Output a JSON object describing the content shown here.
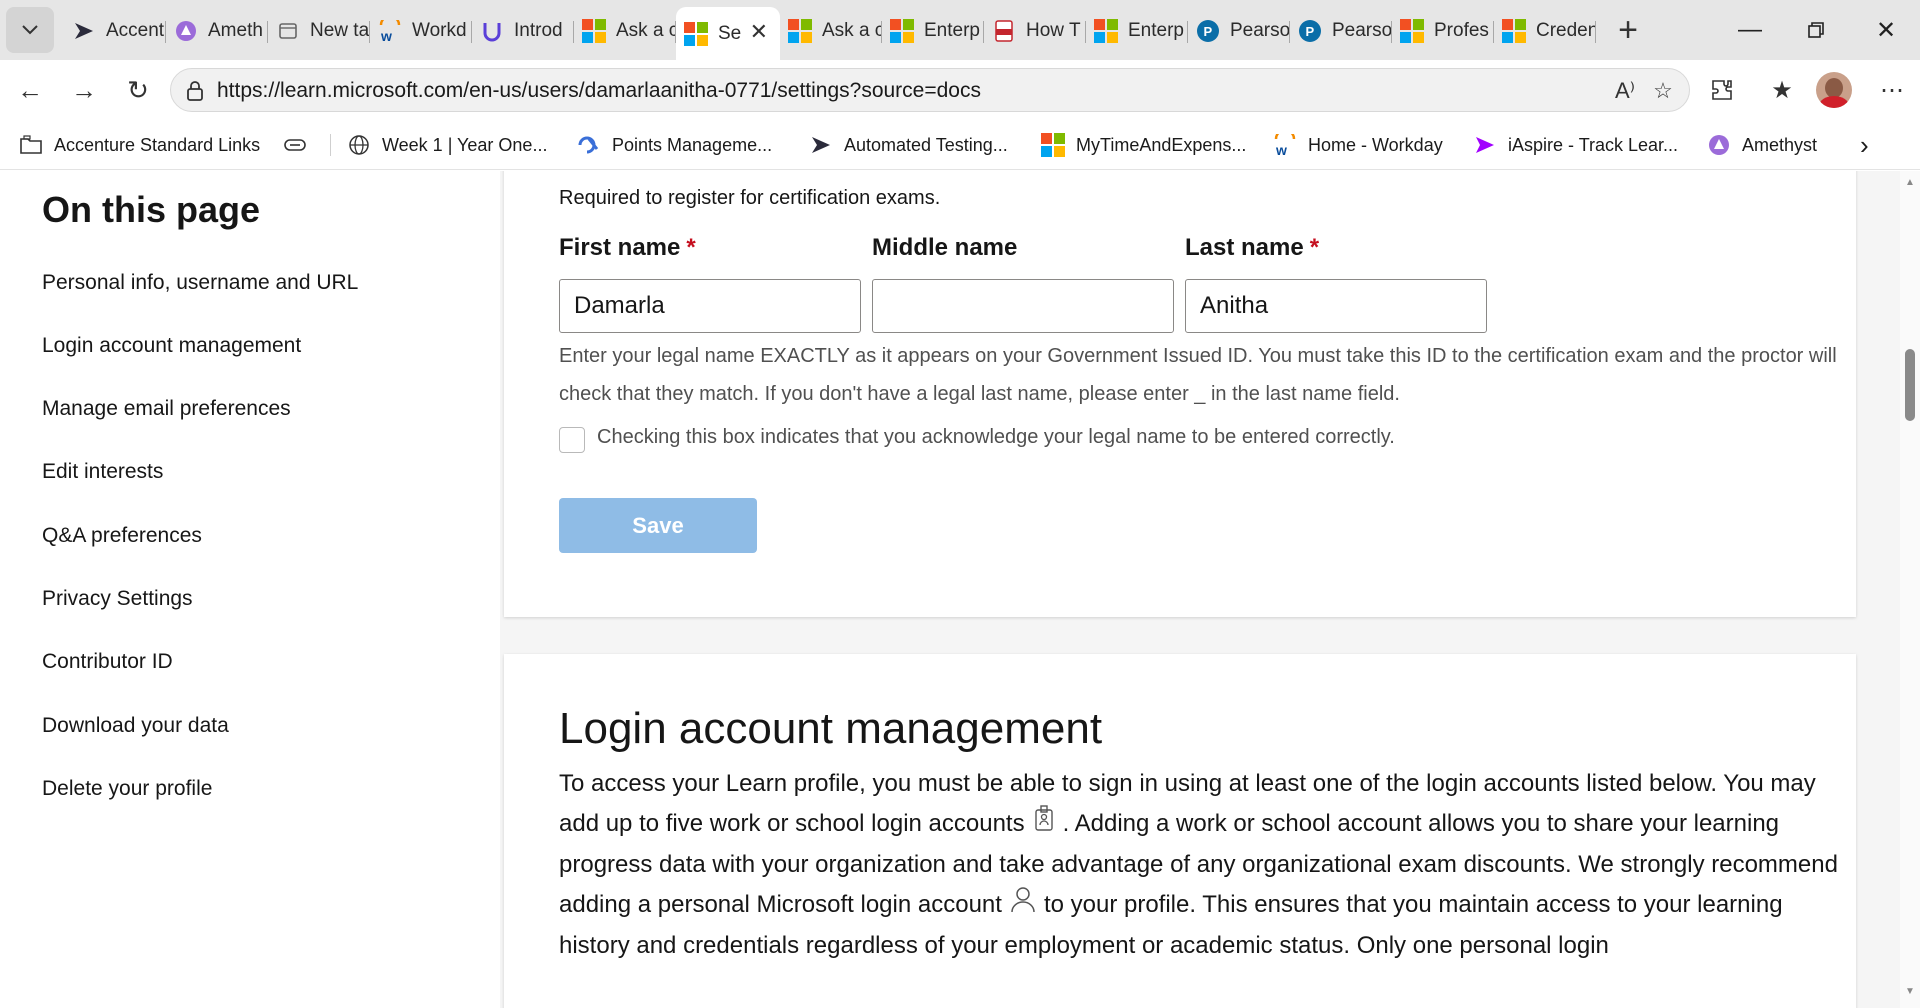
{
  "browser": {
    "tabs": [
      {
        "title": "Accent",
        "icon": "accenture-icon"
      },
      {
        "title": "Ameth",
        "icon": "amethyst-icon"
      },
      {
        "title": "New ta",
        "icon": "new-tab-page-icon"
      },
      {
        "title": "Workd",
        "icon": "workday-icon"
      },
      {
        "title": "Introd",
        "icon": "udemy-icon"
      },
      {
        "title": "Ask a c",
        "icon": "microsoft-icon"
      },
      {
        "title": "Se",
        "icon": "microsoft-icon",
        "active": true
      },
      {
        "title": "Ask a c",
        "icon": "microsoft-icon"
      },
      {
        "title": "Enterp",
        "icon": "microsoft-icon"
      },
      {
        "title": "How T",
        "icon": "pdf-icon"
      },
      {
        "title": "Enterp",
        "icon": "microsoft-icon"
      },
      {
        "title": "Pearso",
        "icon": "pearson-icon"
      },
      {
        "title": "Pearso",
        "icon": "pearson-icon"
      },
      {
        "title": "Profes",
        "icon": "microsoft-icon"
      },
      {
        "title": "Creden",
        "icon": "microsoft-icon"
      }
    ],
    "url": "https://learn.microsoft.com/en-us/users/damarlaanitha-0771/settings?source=docs",
    "bookmarks": [
      {
        "label": "Accenture Standard Links",
        "icon": "folder-icon"
      },
      {
        "label": "",
        "icon": "link-icon"
      },
      {
        "label": "Week 1 | Year One...",
        "icon": "globe-icon"
      },
      {
        "label": "Points Manageme...",
        "icon": "points-icon"
      },
      {
        "label": "Automated Testing...",
        "icon": "accenture-icon"
      },
      {
        "label": "MyTimeAndExpens...",
        "icon": "microsoft-icon"
      },
      {
        "label": "Home - Workday",
        "icon": "workday-icon"
      },
      {
        "label": "iAspire - Track Lear...",
        "icon": "iaspire-icon"
      },
      {
        "label": "Amethyst",
        "icon": "amethyst-icon"
      }
    ]
  },
  "sidebar": {
    "heading": "On this page",
    "links": [
      "Personal info, username and URL",
      "Login account management",
      "Manage email preferences",
      "Edit interests",
      "Q&A preferences",
      "Privacy Settings",
      "Contributor ID",
      "Download your data",
      "Delete your profile"
    ]
  },
  "legal_name_form": {
    "intro": "Required to register for certification exams.",
    "first_name": {
      "label": "First name",
      "required_mark": "*",
      "value": "Damarla"
    },
    "middle_name": {
      "label": "Middle name",
      "value": ""
    },
    "last_name": {
      "label": "Last name",
      "required_mark": "*",
      "value": "Anitha"
    },
    "help_text": "Enter your legal name EXACTLY as it appears on your Government Issued ID. You must take this ID to the certification exam and the proctor will check that they match. If you don't have a legal last name, please enter _ in the last name field.",
    "acknowledge_checked": false,
    "acknowledge_label": "Checking this box indicates that you acknowledge your legal name to be entered correctly.",
    "save_label": "Save"
  },
  "login_section": {
    "title": "Login account management",
    "body_part1": "To access your Learn profile, you must be able to sign in using at least one of the login accounts listed below. You may add up to five work or school login accounts",
    "body_part2": ". Adding a work or school account allows you to share your learning progress data with your organization and take advantage of any organizational exam discounts. We strongly recommend adding a personal Microsoft login account",
    "body_part3": "to your profile. This ensures that you maintain access to your learning history and credentials regardless of your employment or academic status. Only one personal login"
  },
  "colors": {
    "accent": "#0f6cbd",
    "save_disabled": "#8fbce6",
    "required": "#c50f1f"
  }
}
